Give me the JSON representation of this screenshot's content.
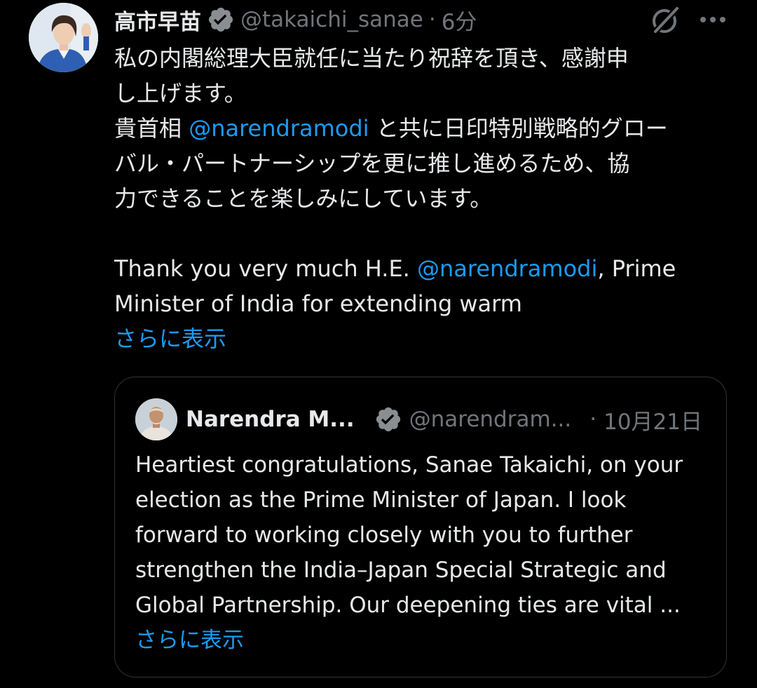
{
  "tweet": {
    "author": {
      "display_name": "高市早苗",
      "handle": "@takaichi_sanae",
      "verified": true
    },
    "separator": "·",
    "time": "6分",
    "text_ja": {
      "line1": "私の内閣総理大臣就任に当たり祝辞を頂き、感謝申",
      "line2": "し上げます。",
      "line3_prefix": "貴首相 ",
      "mention": "@narendramodi",
      "line3_suffix": " と共に日印特別戦略的グロー",
      "line4": "バル・パートナーシップを更に推し進めるため、協",
      "line5": "力できることを楽しみにしています。"
    },
    "text_en": {
      "prefix": "Thank you very much H.E. ",
      "mention": "@narendramodi",
      "suffix": ", Prime",
      "line2": "Minister of India for extending warm"
    },
    "show_more_label": "さらに表示",
    "icons": {
      "grok": "grok-icon",
      "more": "more-options-icon",
      "verified": "verified-badge-icon"
    }
  },
  "quote": {
    "author": {
      "display_name": "Narendra M...",
      "handle": "@narendram...",
      "verified": true
    },
    "separator": "·",
    "time": "10月21日",
    "lines": [
      "Heartiest congratulations, Sanae Takaichi, on your",
      "election as the Prime Minister of Japan. I look",
      "forward to working closely with you to further",
      "strengthen the India–Japan Special Strategic and",
      "Global Partnership. Our deepening ties are vital ..."
    ],
    "show_more_label": "さらに表示"
  },
  "colors": {
    "background": "#000000",
    "text": "#e7e9ea",
    "secondary": "#71767b",
    "accent": "#1d9bf0",
    "border": "#2f3336"
  }
}
